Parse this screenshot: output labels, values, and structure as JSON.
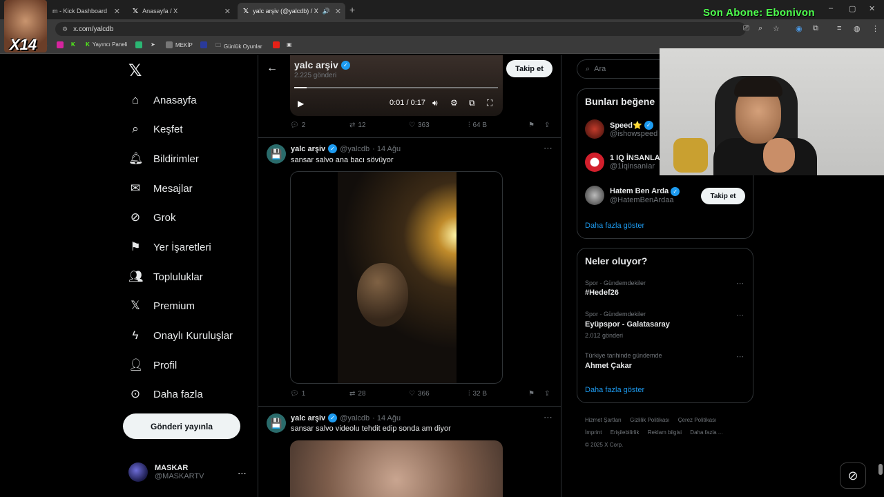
{
  "browser": {
    "tabs": [
      {
        "label": "m - Kick Dashboard"
      },
      {
        "label": "Anasayfa / X"
      },
      {
        "label": "yalc arşiv (@yalcdb) / X"
      }
    ],
    "url": "x.com/yalcdb",
    "bookmarks": [
      "Yayıncı Paneli",
      "MEKİP",
      "Günlük Oyunlar"
    ]
  },
  "overlay": {
    "sub_text": "Son Abone: Ebonivon",
    "streamer_tag": "X14"
  },
  "nav": {
    "items": [
      "Anasayfa",
      "Keşfet",
      "Bildirimler",
      "Mesajlar",
      "Grok",
      "Yer İşaretleri",
      "Topluluklar",
      "Premium",
      "Onaylı Kuruluşlar",
      "Profil",
      "Daha fazla"
    ],
    "post_button": "Gönderi yayınla",
    "account_name": "MASKAR",
    "account_handle": "@MASKARTV"
  },
  "profile": {
    "name": "yalc arşiv",
    "posts": "2.225 gönderi",
    "follow_label": "Takip et"
  },
  "video1": {
    "time": "0:01 / 0:17",
    "progress": 0.06
  },
  "stats1": {
    "replies": "2",
    "reposts": "12",
    "likes": "363",
    "views": "64 B"
  },
  "tweets": [
    {
      "name": "yalc arşiv",
      "handle": "@yalcdb",
      "date": "· 14 Ağu",
      "text": "sansar salvo ana bacı sövüyor",
      "replies": "1",
      "reposts": "28",
      "likes": "366",
      "views": "32 B"
    },
    {
      "name": "yalc arşiv",
      "handle": "@yalcdb",
      "date": "· 14 Ağu",
      "text": "sansar salvo videolu tehdit edip sonda am diyor"
    }
  ],
  "search": {
    "placeholder": "Ara"
  },
  "who_to_follow": {
    "title": "Bunları beğene",
    "people": [
      {
        "name": "Speed⭐",
        "handle": "@ishowspeed"
      },
      {
        "name": "1 IQ İNSANLA",
        "handle": "@1iqinsanIar"
      },
      {
        "name": "Hatem Ben Arda",
        "handle": "@HatemBenArdaa"
      }
    ],
    "follow_label": "Takip et",
    "show_more": "Daha fazla göster"
  },
  "trends": {
    "title": "Neler oluyor?",
    "items": [
      {
        "category": "Spor · Gündemdekiler",
        "name": "#Hedef26",
        "count": ""
      },
      {
        "category": "Spor · Gündemdekiler",
        "name": "Eyüpspor - Galatasaray",
        "count": "2.012 gönderi"
      },
      {
        "category": "Türkiye tarihinde gündemde",
        "name": "Ahmet Çakar",
        "count": ""
      }
    ],
    "show_more": "Daha fazla göster"
  },
  "footer": {
    "links": [
      "Hizmet Şartları",
      "Gizlilik Politikası",
      "Çerez Politikası",
      "İmprint",
      "Erişilebilirlik",
      "Reklam bilgisi",
      "Daha fazla ..."
    ],
    "copyright": "© 2025 X Corp."
  },
  "colors": {
    "accent": "#1d9bf0",
    "overlay_text": "#4dff4d",
    "background": "#000000"
  }
}
